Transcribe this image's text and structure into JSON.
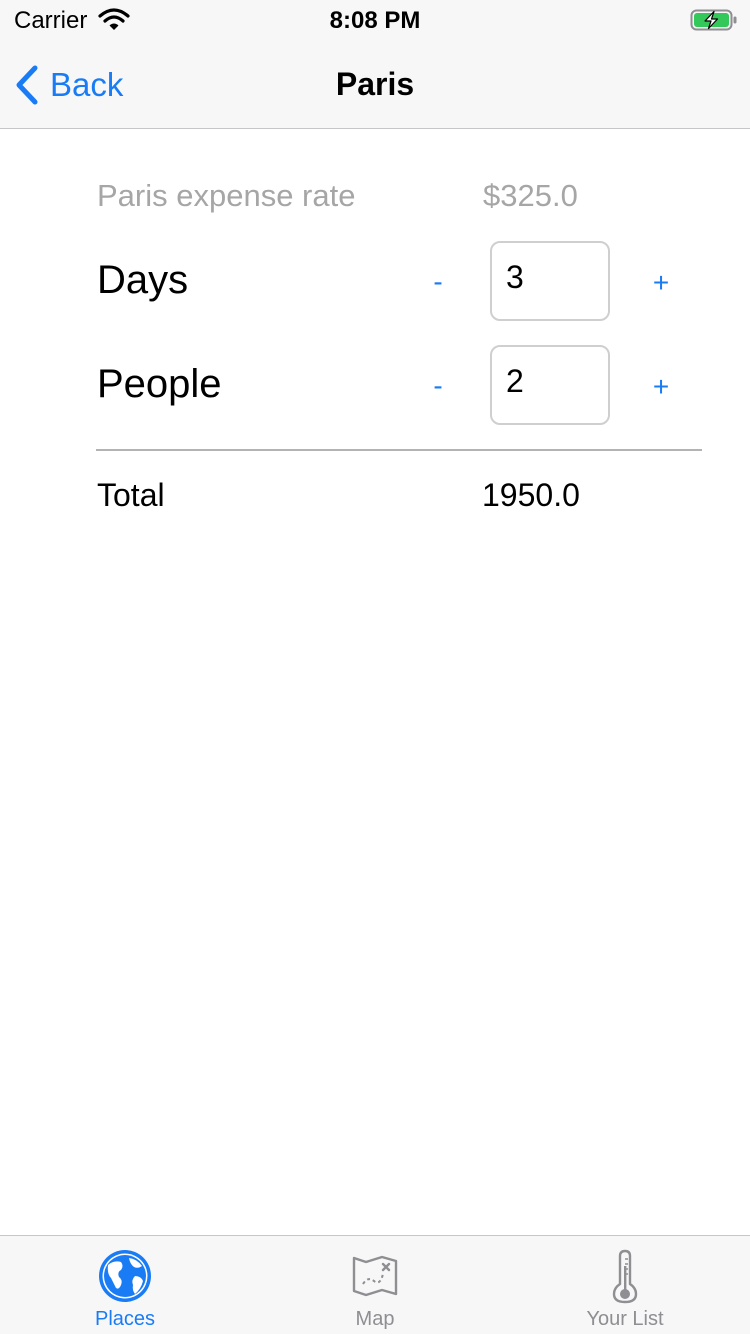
{
  "status_bar": {
    "carrier": "Carrier",
    "time": "8:08 PM",
    "icons": [
      "wifi-icon",
      "battery-charging-icon"
    ]
  },
  "nav": {
    "back_label": "Back",
    "title": "Paris"
  },
  "rate": {
    "label": "Paris expense rate",
    "value": "$325.0"
  },
  "days": {
    "label": "Days",
    "minus": "-",
    "value": "3",
    "plus": "+"
  },
  "people": {
    "label": "People",
    "minus": "-",
    "value": "2",
    "plus": "+"
  },
  "total": {
    "label": "Total",
    "value": "1950.0"
  },
  "tabs": [
    {
      "label": "Places",
      "icon": "globe-icon",
      "active": true
    },
    {
      "label": "Map",
      "icon": "map-icon",
      "active": false
    },
    {
      "label": "Your List",
      "icon": "thermometer-icon",
      "active": false
    }
  ],
  "colors": {
    "accent": "#1a7cf5",
    "muted_text": "#a6a6a6",
    "tab_inactive": "#8e8e93",
    "battery_charge": "#34c759"
  }
}
